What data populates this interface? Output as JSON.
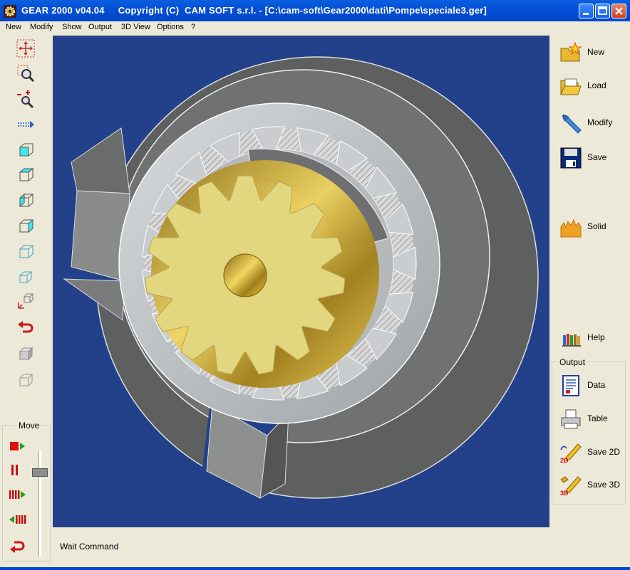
{
  "window": {
    "title": "GEAR 2000 v04.04     Copyright (C)  CAM SOFT s.r.l. - [C:\\cam-soft\\Gear2000\\dati\\Pompe\\speciale3.ger]"
  },
  "menu": [
    "New",
    "Modify",
    "Show",
    "Output",
    "3D View",
    "Options",
    "?"
  ],
  "move_panel": {
    "label": "Move"
  },
  "right_buttons": {
    "new": "New",
    "load": "Load",
    "modify": "Modify",
    "save": "Save",
    "solid": "Solid",
    "help": "Help"
  },
  "output_panel": {
    "label": "Output",
    "data": "Data",
    "table": "Table",
    "save2d": "Save 2D",
    "save3d": "Save 3D"
  },
  "status": {
    "text": "Wait Command"
  },
  "colors": {
    "title_bar": "#0450d6",
    "viewport_bg": "#23418a",
    "gear": "#e0d27a",
    "housing": "#6f7070"
  },
  "icons": [
    "pan-icon",
    "zoom-window-icon",
    "zoom-in-out-icon",
    "move-right-icon",
    "view-front-cube-icon",
    "view-top-cube-icon",
    "view-left-cube-icon",
    "view-right-cube-icon",
    "view-iso-cube-icon",
    "view-iso2-cube-icon",
    "axes-cube-icon",
    "undo-red-icon",
    "shaded-cube-icon",
    "wire-cube-icon"
  ]
}
